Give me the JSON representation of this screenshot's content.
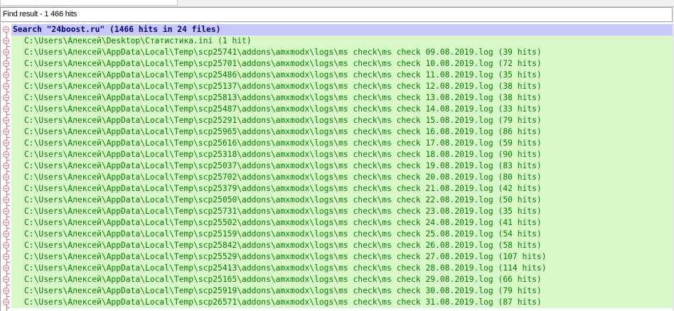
{
  "window": {
    "title": "Find result - 1 466 hits"
  },
  "search": {
    "label": "Search \"24boost.ru\" (1466 hits in 24 files)"
  },
  "results": [
    "C:\\Users\\Алексей\\Desktop\\Статистика.ini (1 hit)",
    "C:\\Users\\Алексей\\AppData\\Local\\Temp\\scp25741\\addons\\amxmodx\\logs\\ms check\\ms check 09.08.2019.log (39 hits)",
    "C:\\Users\\Алексей\\AppData\\Local\\Temp\\scp25701\\addons\\amxmodx\\logs\\ms check\\ms check 10.08.2019.log (72 hits)",
    "C:\\Users\\Алексей\\AppData\\Local\\Temp\\scp25486\\addons\\amxmodx\\logs\\ms check\\ms check 11.08.2019.log (35 hits)",
    "C:\\Users\\Алексей\\AppData\\Local\\Temp\\scp25137\\addons\\amxmodx\\logs\\ms check\\ms check 12.08.2019.log (38 hits)",
    "C:\\Users\\Алексей\\AppData\\Local\\Temp\\scp25813\\addons\\amxmodx\\logs\\ms check\\ms check 13.08.2019.log (38 hits)",
    "C:\\Users\\Алексей\\AppData\\Local\\Temp\\scp25487\\addons\\amxmodx\\logs\\ms check\\ms check 14.08.2019.log (33 hits)",
    "C:\\Users\\Алексей\\AppData\\Local\\Temp\\scp25291\\addons\\amxmodx\\logs\\ms check\\ms check 15.08.2019.log (79 hits)",
    "C:\\Users\\Алексей\\AppData\\Local\\Temp\\scp25965\\addons\\amxmodx\\logs\\ms check\\ms check 16.08.2019.log (86 hits)",
    "C:\\Users\\Алексей\\AppData\\Local\\Temp\\scp25616\\addons\\amxmodx\\logs\\ms check\\ms check 17.08.2019.log (59 hits)",
    "C:\\Users\\Алексей\\AppData\\Local\\Temp\\scp25318\\addons\\amxmodx\\logs\\ms check\\ms check 18.08.2019.log (90 hits)",
    "C:\\Users\\Алексей\\AppData\\Local\\Temp\\scp25037\\addons\\amxmodx\\logs\\ms check\\ms check 19.08.2019.log (83 hits)",
    "C:\\Users\\Алексей\\AppData\\Local\\Temp\\scp25702\\addons\\amxmodx\\logs\\ms check\\ms check 20.08.2019.log (80 hits)",
    "C:\\Users\\Алексей\\AppData\\Local\\Temp\\scp25379\\addons\\amxmodx\\logs\\ms check\\ms check 21.08.2019.log (42 hits)",
    "C:\\Users\\Алексей\\AppData\\Local\\Temp\\scp25050\\addons\\amxmodx\\logs\\ms check\\ms check 22.08.2019.log (50 hits)",
    "C:\\Users\\Алексей\\AppData\\Local\\Temp\\scp25731\\addons\\amxmodx\\logs\\ms check\\ms check 23.08.2019.log (35 hits)",
    "C:\\Users\\Алексей\\AppData\\Local\\Temp\\scp25502\\addons\\amxmodx\\logs\\ms check\\ms check 24.08.2019.log (41 hits)",
    "C:\\Users\\Алексей\\AppData\\Local\\Temp\\scp25159\\addons\\amxmodx\\logs\\ms check\\ms check 25.08.2019.log (54 hits)",
    "C:\\Users\\Алексей\\AppData\\Local\\Temp\\scp25842\\addons\\amxmodx\\logs\\ms check\\ms check 26.08.2019.log (58 hits)",
    "C:\\Users\\Алексей\\AppData\\Local\\Temp\\scp25529\\addons\\amxmodx\\logs\\ms check\\ms check 27.08.2019.log (107 hits)",
    "C:\\Users\\Алексей\\AppData\\Local\\Temp\\scp25413\\addons\\amxmodx\\logs\\ms check\\ms check 28.08.2019.log (114 hits)",
    "C:\\Users\\Алексей\\AppData\\Local\\Temp\\scp25165\\addons\\amxmodx\\logs\\ms check\\ms check 29.08.2019.log (66 hits)",
    "C:\\Users\\Алексей\\AppData\\Local\\Temp\\scp25919\\addons\\amxmodx\\logs\\ms check\\ms check 30.08.2019.log (79 hits)",
    "C:\\Users\\Алексей\\AppData\\Local\\Temp\\scp26571\\addons\\amxmodx\\logs\\ms check\\ms check 31.08.2019.log (87 hits)"
  ],
  "icons": {
    "fold": "collapse-fold-icon"
  },
  "colors": {
    "search_bg": "#c8c8ff",
    "search_text": "#000080",
    "file_bg": "#d8f8c8",
    "file_text": "#008000",
    "fold_marker": "#e07070"
  }
}
